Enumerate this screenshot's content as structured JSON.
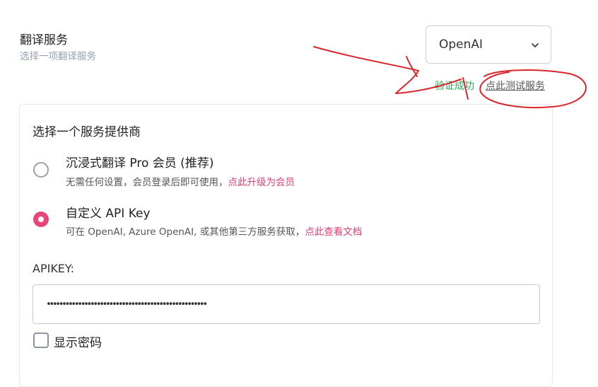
{
  "header": {
    "title": "翻译服务",
    "subtitle": "选择一项翻译服务"
  },
  "service_select": {
    "value": "OpenAI",
    "chevron_icon": "chevron-down-icon"
  },
  "status": {
    "verify_text": "验证成功",
    "test_link": "点此测试服务",
    "verify_color": "#2eaa5b"
  },
  "provider": {
    "title": "选择一个服务提供商",
    "options": [
      {
        "label": "沉浸式翻译 Pro 会员 (推荐)",
        "desc": "无需任何设置，会员登录后即可使用，",
        "link": "点此升级为会员",
        "selected": false
      },
      {
        "label": "自定义 API Key",
        "desc": "可在 OpenAI, Azure OpenAI, 或其他第三方服务获取，",
        "link": "点此查看文档",
        "selected": true
      }
    ]
  },
  "apikey": {
    "label": "APIKEY:",
    "value": "sk-XXXXXXXXXXXXXXXXXXXXXXXXXXXXXXXXXXXXXXXXXXXXXXXX",
    "show_password_label": "显示密码",
    "show_password_checked": false
  },
  "colors": {
    "accent": "#e8457a",
    "link_pink": "#e03c75",
    "annotation_red": "#d9262c"
  }
}
